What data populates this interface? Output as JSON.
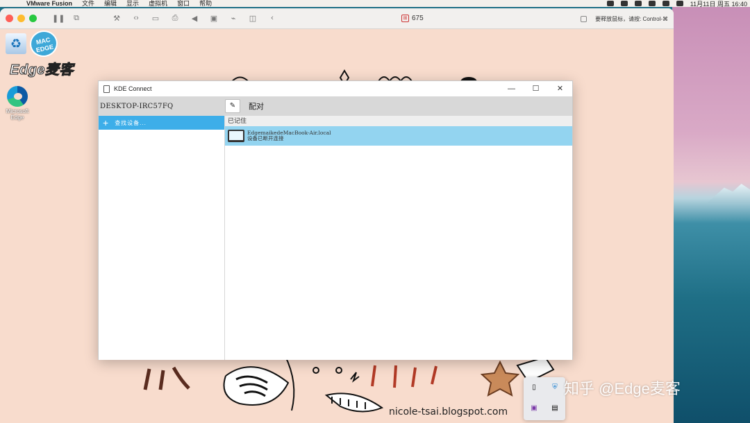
{
  "menubar": {
    "app": "VMware Fusion",
    "items": [
      "文件",
      "编辑",
      "显示",
      "虚拟机",
      "窗口",
      "帮助"
    ],
    "clock": "11月11日 周五 16:40"
  },
  "vmware": {
    "title": "675",
    "hint": "要释放鼠标，请按: Control-⌘"
  },
  "desktop": {
    "logo_circle": "MAC\nEDGE",
    "logo_text": "Edge麦客",
    "icons": [
      {
        "label": "回收站"
      },
      {
        "label": "Microsoft Edge"
      }
    ],
    "blog": "nicole-tsai.blogspot.com"
  },
  "kde": {
    "title": "KDE Connect",
    "hostname": "DESKTOP-IRC57FQ",
    "pair_label": "配对",
    "find_devices": "查找设备...",
    "remembered_section": "已记住",
    "device": {
      "name": "EdgemaikedeMacBook-Air.local",
      "status": "设备已断开连接"
    },
    "window_buttons": {
      "minimize": "—",
      "maximize": "☐",
      "close": "✕"
    }
  },
  "watermark": "知乎 @Edge麦客",
  "colors": {
    "accent": "#3daee9",
    "selected_row": "#93d4f0",
    "desktop_bg": "#f8dccd"
  }
}
